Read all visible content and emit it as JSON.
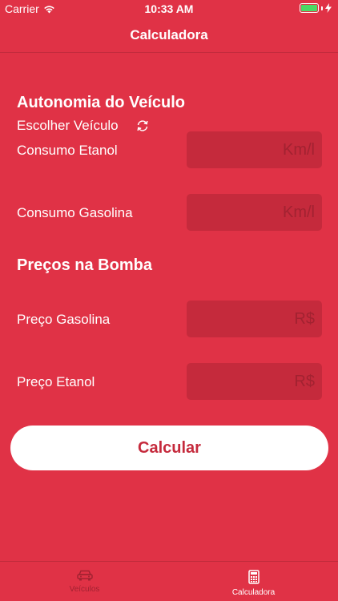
{
  "status_bar": {
    "carrier": "Carrier",
    "time": "10:33 AM",
    "battery_color": "#4CD964"
  },
  "nav": {
    "title": "Calculadora"
  },
  "autonomy": {
    "title": "Autonomia do Veículo",
    "choose_vehicle": "Escolher Veículo",
    "ethanol_label": "Consumo Etanol",
    "ethanol_placeholder": "Km/l",
    "gasoline_label": "Consumo Gasolina",
    "gasoline_placeholder": "Km/l"
  },
  "prices": {
    "title": "Preços na Bomba",
    "gasoline_label": "Preço Gasolina",
    "gasoline_placeholder": "R$",
    "ethanol_label": "Preço Etanol",
    "ethanol_placeholder": "R$"
  },
  "calculate_label": "Calcular",
  "tabs": [
    {
      "label": "Veículos",
      "icon": "car-icon",
      "active": false
    },
    {
      "label": "Calculadora",
      "icon": "calculator-icon",
      "active": true
    }
  ],
  "colors": {
    "background": "#E03246",
    "field": "#C52A3C",
    "accent_text": "#C52A3C"
  }
}
